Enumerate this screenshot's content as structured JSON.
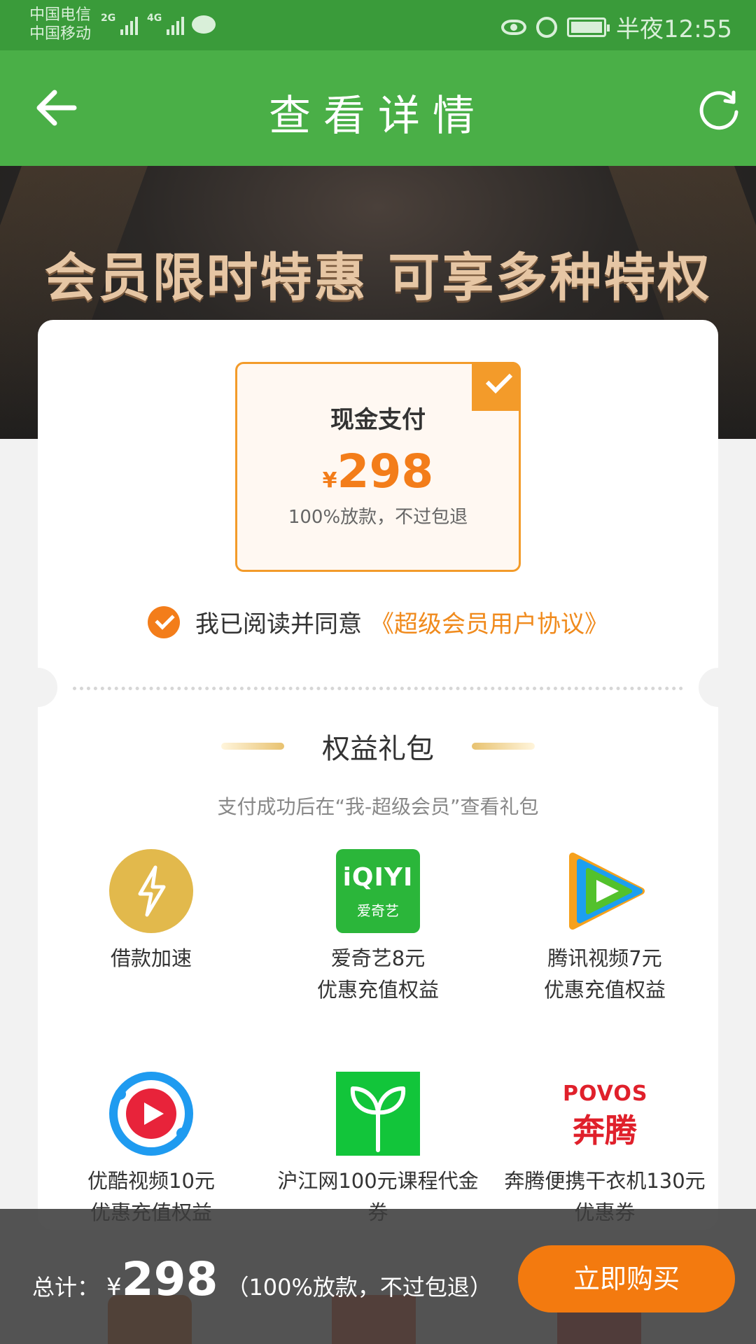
{
  "status_bar": {
    "carrier1": "中国电信",
    "carrier2": "中国移动",
    "net1": "2G",
    "net2": "4G",
    "time": "半夜12:55"
  },
  "nav": {
    "title": "查看详情",
    "back_icon": "arrow-left-icon",
    "refresh_icon": "refresh-icon"
  },
  "banner": {
    "text": "会员限时特惠 可享多种特权"
  },
  "payment_option": {
    "name": "现金支付",
    "currency": "¥",
    "price": "298",
    "note": "100%放款，不过包退",
    "selected": true
  },
  "agreement": {
    "prefix": "我已阅读并同意",
    "link": "《超级会员用户协议》",
    "checked": true
  },
  "benefits": {
    "title": "权益礼包",
    "subtitle": "支付成功后在“我-超级会员”查看礼包",
    "items": [
      {
        "line1": "借款加速",
        "line2": "",
        "icon": "lightning-icon"
      },
      {
        "line1": "爱奇艺8元",
        "line2": "优惠充值权益",
        "icon": "iqiyi-logo-icon",
        "logo_text": "iQIYI",
        "logo_sub": "爱奇艺"
      },
      {
        "line1": "腾讯视频7元",
        "line2": "优惠充值权益",
        "icon": "tencent-video-icon"
      },
      {
        "line1": "优酷视频10元",
        "line2": "优惠充值权益",
        "icon": "youku-icon"
      },
      {
        "line1": "沪江网100元课程代金",
        "line2": "券",
        "icon": "hujiang-sprout-icon"
      },
      {
        "line1": "奔腾便携干衣机130元",
        "line2": "优惠券",
        "icon": "povos-logo-icon",
        "logo_text": "POVOS",
        "logo_sub": "奔腾"
      }
    ]
  },
  "footer": {
    "total_label": "总计：",
    "currency": "¥",
    "amount": "298",
    "note": "（100%放款，不过包退）",
    "buy_button": "立即购买"
  },
  "colors": {
    "green_nav": "#4aaf47",
    "orange": "#f37d1a",
    "gold": "#e2b94c"
  }
}
